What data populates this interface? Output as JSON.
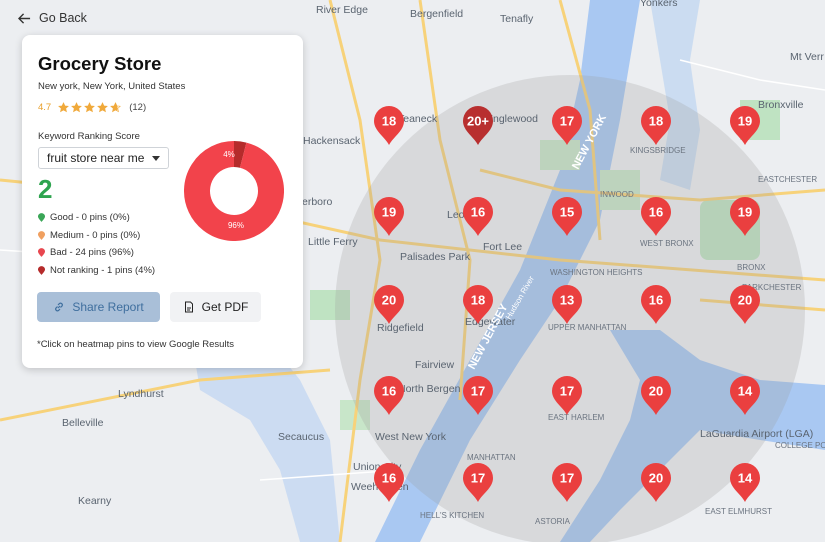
{
  "back_label": "Go Back",
  "business": {
    "name": "Grocery Store",
    "address": "New york, New York, United States",
    "rating": "4.7",
    "review_count": "(12)",
    "stars_value": 4.7
  },
  "ranking": {
    "label": "Keyword Ranking Score",
    "keyword": "fruit store near me",
    "score": "2",
    "legend": [
      {
        "text": "Good - 0 pins (0%)",
        "color": "#3aa657"
      },
      {
        "text": "Medium - 0 pins (0%)",
        "color": "#f0a060"
      },
      {
        "text": "Bad - 24 pins (96%)",
        "color": "#e8474f"
      },
      {
        "text": "Not ranking - 1 pins (4%)",
        "color": "#b52b2b"
      }
    ],
    "donut": {
      "bad_pct": 96,
      "not_ranking_pct": 4,
      "bad_label": "96%",
      "not_label": "4%",
      "bad_color": "#f2434b",
      "not_color": "#b52b2b"
    }
  },
  "actions": {
    "share": "Share Report",
    "pdf": "Get PDF"
  },
  "note": "*Click on heatmap pins to view Google Results",
  "colors": {
    "pin": "#ea3f3f",
    "pin_dark": "#b82f2f",
    "accent_green": "#2ea44f"
  },
  "map_labels": [
    "River Edge",
    "Bergenfield",
    "Tenafly",
    "Yonkers",
    "Mt Verr",
    "Hackensack",
    "Teaneck",
    "Englewood",
    "KINGSBRIDGE",
    "Bronxville",
    "EASTCHESTER",
    "Teterboro",
    "Leonia",
    "Fort Lee",
    "INWOOD",
    "WEST BRONX",
    "BRONX",
    "Little Ferry",
    "Palisades Park",
    "WASHINGTON HEIGHTS",
    "PARKCHESTER",
    "Ridgefield",
    "Edgewater",
    "UPPER MANHATTAN",
    "Fairview",
    "North Bergen",
    "Lyndhurst",
    "EAST HARLEM",
    "Belleville",
    "West New York",
    "Secaucus",
    "LaGuardia Airport (LGA)",
    "COLLEGE POINT",
    "MANHATTAN",
    "Union City",
    "Weehawken",
    "Kearny",
    "HELL'S KITCHEN",
    "EAST ELMHURST",
    "ASTORIA",
    "NEW JERSEY",
    "NEW YORK",
    "Hudson River"
  ],
  "pins": [
    {
      "label": "18",
      "dark": false
    },
    {
      "label": "20+",
      "dark": true
    },
    {
      "label": "17",
      "dark": false
    },
    {
      "label": "18",
      "dark": false
    },
    {
      "label": "19",
      "dark": false
    },
    {
      "label": "19",
      "dark": false
    },
    {
      "label": "16",
      "dark": false
    },
    {
      "label": "15",
      "dark": false
    },
    {
      "label": "16",
      "dark": false
    },
    {
      "label": "19",
      "dark": false
    },
    {
      "label": "20",
      "dark": false
    },
    {
      "label": "18",
      "dark": false
    },
    {
      "label": "13",
      "dark": false
    },
    {
      "label": "16",
      "dark": false
    },
    {
      "label": "20",
      "dark": false
    },
    {
      "label": "16",
      "dark": false
    },
    {
      "label": "17",
      "dark": false
    },
    {
      "label": "17",
      "dark": false
    },
    {
      "label": "20",
      "dark": false
    },
    {
      "label": "14",
      "dark": false
    },
    {
      "label": "16",
      "dark": false
    },
    {
      "label": "17",
      "dark": false
    },
    {
      "label": "17",
      "dark": false
    },
    {
      "label": "20",
      "dark": false
    },
    {
      "label": "14",
      "dark": false
    }
  ]
}
